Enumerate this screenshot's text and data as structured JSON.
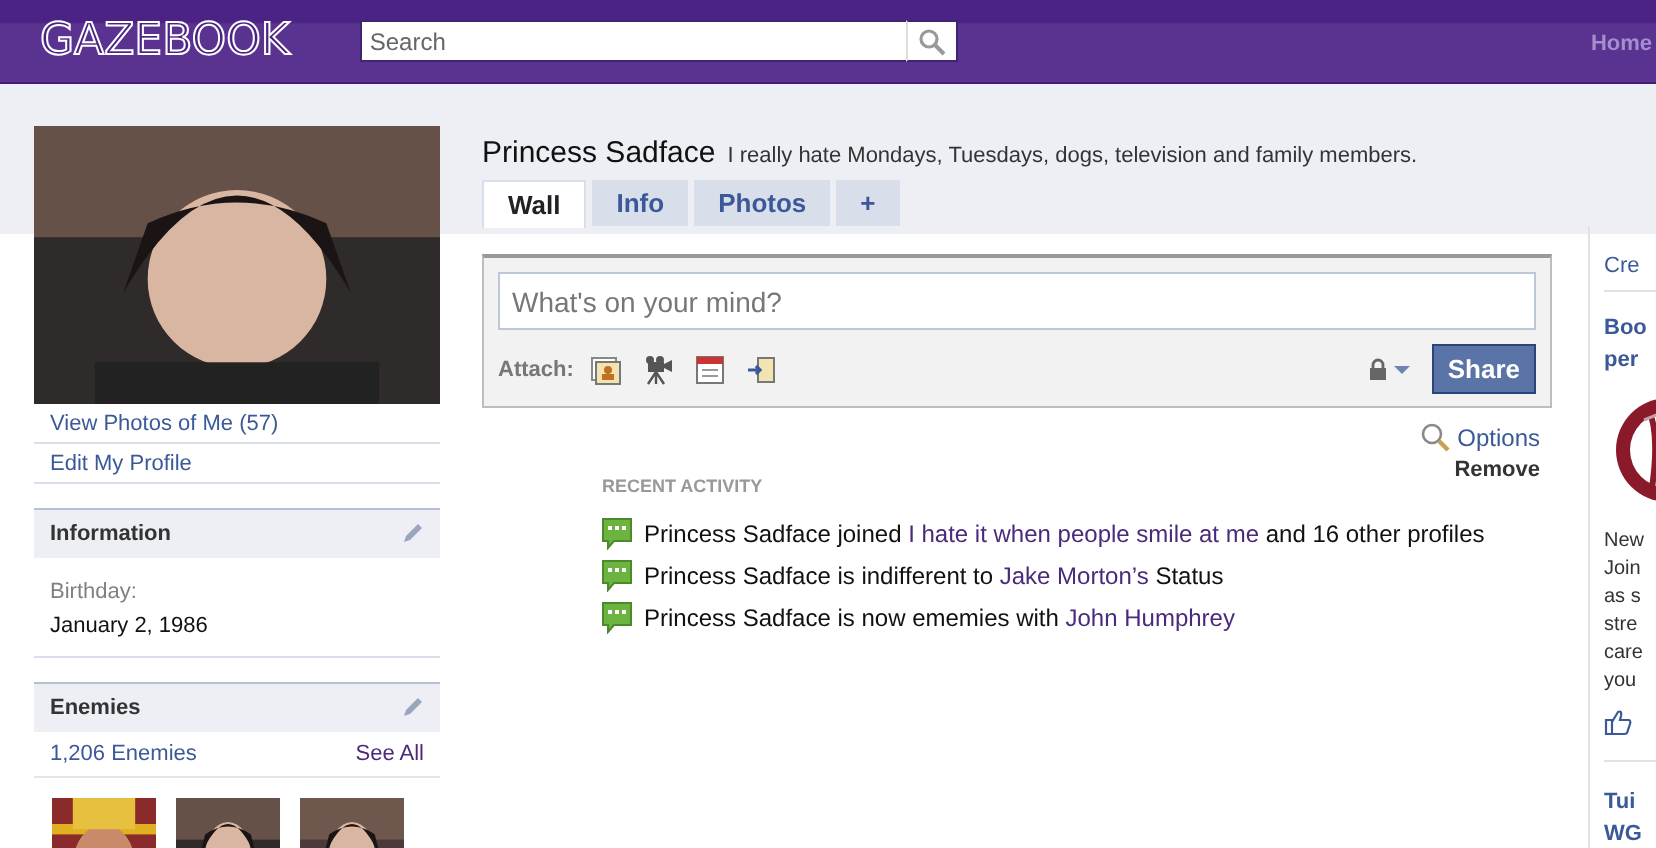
{
  "header": {
    "logo": "GAZEBOOK",
    "search": {
      "placeholder": "Search"
    },
    "nav": [
      "Home"
    ]
  },
  "profile": {
    "name": "Princess Sadface",
    "status": "I really hate Mondays, Tuesdays, dogs, television and family members."
  },
  "tabs": [
    {
      "label": "Wall",
      "selected": true
    },
    {
      "label": "Info",
      "selected": false
    },
    {
      "label": "Photos",
      "selected": false
    },
    {
      "label": "+",
      "selected": false
    }
  ],
  "sidebar": {
    "links": [
      "View Photos of Me (57)",
      "Edit My Profile"
    ],
    "information": {
      "title": "Information",
      "field_label": "Birthday:",
      "field_value": "January 2, 1986"
    },
    "enemies": {
      "title": "Enemies",
      "count": "1,206 Enemies",
      "see_all": "See All"
    }
  },
  "composer": {
    "placeholder": "What's on your mind?",
    "attach_label": "Attach:",
    "share": "Share"
  },
  "options": {
    "label": "Options",
    "remove": "Remove"
  },
  "recent_activity": {
    "title": "RECENT ACTIVITY",
    "items": [
      {
        "parts": [
          {
            "kind": "plain",
            "text": "Princess Sadface joined "
          },
          {
            "kind": "link",
            "text": "I hate it when people smile at me"
          },
          {
            "kind": "plain",
            "text": " and 16 other profiles"
          }
        ]
      },
      {
        "parts": [
          {
            "kind": "plain",
            "text": "Princess Sadface is indifferent to "
          },
          {
            "kind": "link",
            "text": "Jake Morton’s"
          },
          {
            "kind": "plain",
            "text": " Status"
          }
        ]
      },
      {
        "parts": [
          {
            "kind": "plain",
            "text": "Princess Sadface is now ememies with "
          },
          {
            "kind": "link",
            "text": "John Humphrey"
          }
        ]
      }
    ]
  },
  "ads": {
    "header": "Cre",
    "items": [
      {
        "title_lines": [
          "Boo",
          "per"
        ],
        "body_lines": [
          "New",
          "Join",
          "as s",
          "stre",
          "care",
          "you"
        ]
      },
      {
        "title_lines": [
          "Tui",
          "WG"
        ]
      }
    ]
  }
}
